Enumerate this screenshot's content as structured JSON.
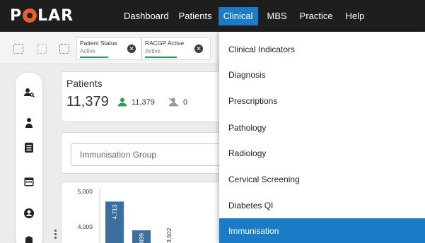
{
  "app": {
    "logo_text_left": "P",
    "logo_text_right": "LAR"
  },
  "nav": {
    "items": [
      {
        "label": "Dashboard"
      },
      {
        "label": "Patients"
      },
      {
        "label": "Clinical"
      },
      {
        "label": "MBS"
      },
      {
        "label": "Practice"
      },
      {
        "label": "Help"
      }
    ],
    "active": "Clinical"
  },
  "filters": {
    "chips": [
      {
        "title": "Patient Status",
        "status": "Active"
      },
      {
        "title": "RACGP Active",
        "status": "Active"
      }
    ],
    "icons": [
      "expand-icon",
      "collapse-icon",
      "filter-settings-icon"
    ]
  },
  "sidebar": {
    "icons": [
      "patient-search-icon",
      "patient-user-icon",
      "list-icon",
      "calendar-icon",
      "account-icon",
      "clipboard-icon"
    ]
  },
  "patients": {
    "title": "Patients",
    "total": "11,379",
    "active_count": "11,379",
    "inactive_count": "0"
  },
  "group_select": {
    "placeholder": "Immunisation Group"
  },
  "chart_data": {
    "type": "bar",
    "y_ticks": [
      "5,000",
      "4,000"
    ],
    "ylim": [
      3500,
      5500
    ],
    "values": [
      4713,
      3899,
      3502
    ],
    "value_labels": [
      "4,713",
      "3,899",
      "3,502"
    ],
    "color": "#3a6f9e"
  },
  "dropdown": {
    "items": [
      {
        "label": "Clinical Indicators"
      },
      {
        "label": "Diagnosis"
      },
      {
        "label": "Prescriptions"
      },
      {
        "label": "Pathology"
      },
      {
        "label": "Radiology"
      },
      {
        "label": "Cervical Screening"
      },
      {
        "label": "Diabetes QI"
      },
      {
        "label": "Immunisation"
      }
    ],
    "selected": "Immunisation"
  },
  "colors": {
    "accent": "#1a7bc7",
    "topbar": "#1e1e1e",
    "green": "#2d9b54",
    "logo_o": "#e8602c"
  }
}
